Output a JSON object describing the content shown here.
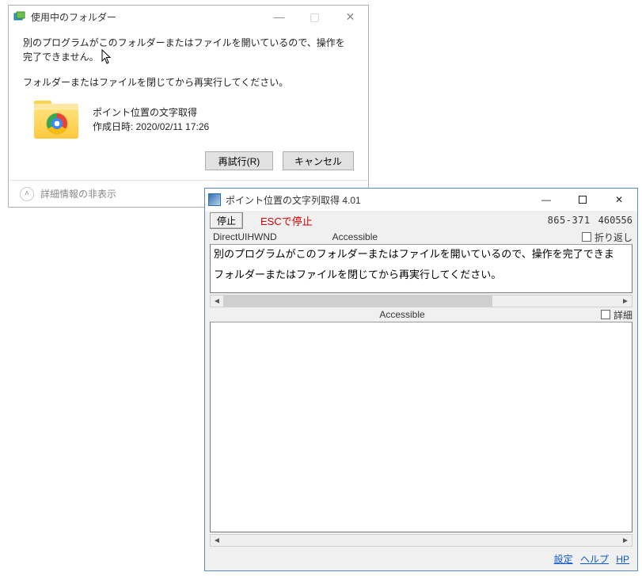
{
  "dialog": {
    "title": "使用中のフォルダー",
    "message1": "別のプログラムがこのフォルダーまたはファイルを開いているので、操作を完了できません。",
    "message2": "フォルダーまたはファイルを閉じてから再実行してください。",
    "item_name": "ポイント位置の文字取得",
    "item_created_label": "作成日時: 2020/02/11 17:26",
    "retry_label": "再試行(R)",
    "cancel_label": "キャンセル",
    "footer_label": "詳細情報の非表示"
  },
  "tool": {
    "title": "ポイント位置の文字列取得 4.01",
    "stop_label": "停止",
    "esc_label": "ESCで停止",
    "coords": "865-371",
    "hex": "460556",
    "class_label": "DirectUIHWND",
    "accessible_label": "Accessible",
    "wrap_label": "折り返し",
    "detail_label": "詳細",
    "captured_line1": "別のプログラムがこのフォルダーまたはファイルを開いているので、操作を完了できま",
    "captured_line2": "フォルダーまたはファイルを閉じてから再実行してください。",
    "link_settings": "設定",
    "link_help": "ヘルプ",
    "link_hp": "HP"
  }
}
